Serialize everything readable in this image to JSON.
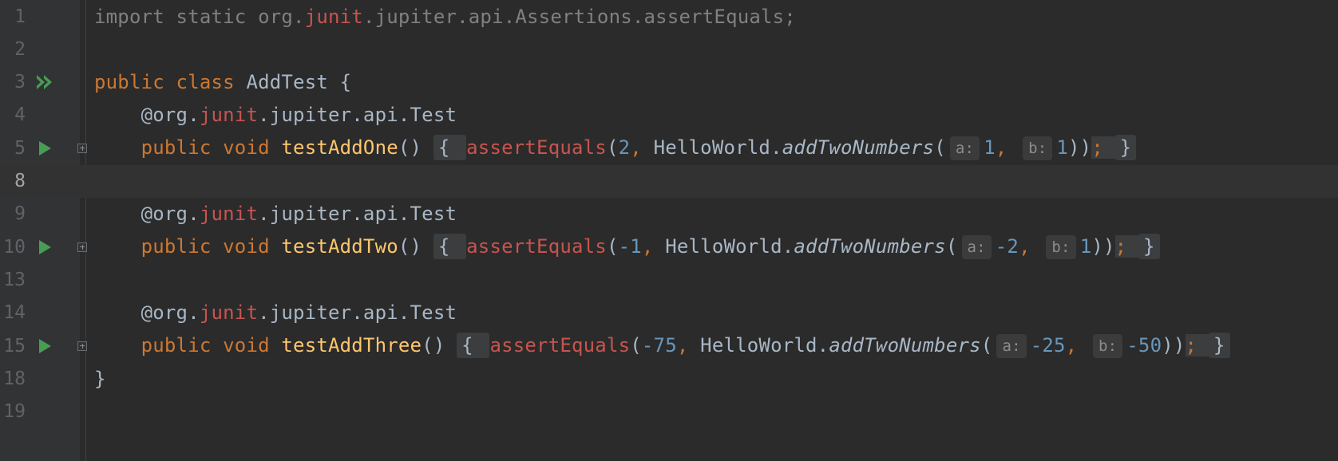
{
  "lines": [
    {
      "num": "1",
      "tokens": [
        {
          "t": "import static org.",
          "c": "muted"
        },
        {
          "t": "junit",
          "c": "red"
        },
        {
          "t": ".jupiter.api.Assertions.assertEquals;",
          "c": "muted"
        }
      ]
    },
    {
      "num": "2",
      "tokens": []
    },
    {
      "num": "3",
      "gutter": "run-all",
      "tokens": [
        {
          "t": "public class ",
          "c": "kw"
        },
        {
          "t": "AddTest ",
          "c": "punc"
        },
        {
          "t": "{",
          "c": "punc"
        }
      ]
    },
    {
      "num": "4",
      "tokens": [
        {
          "t": "    @org.",
          "c": "punc"
        },
        {
          "t": "junit",
          "c": "red"
        },
        {
          "t": ".jupiter.api.Test",
          "c": "punc"
        }
      ]
    },
    {
      "num": "5",
      "gutter": "run",
      "fold": true,
      "tokens": [
        {
          "t": "    public void ",
          "c": "kw"
        },
        {
          "t": "testAddOne",
          "c": "fn"
        },
        {
          "t": "() ",
          "c": "punc"
        },
        {
          "t": "{ ",
          "c": "fold-box"
        },
        {
          "t": "assertEquals",
          "c": "red"
        },
        {
          "t": "(",
          "c": "punc"
        },
        {
          "t": "2",
          "c": "num"
        },
        {
          "t": ", ",
          "c": "kw"
        },
        {
          "t": "HelloWorld.",
          "c": "punc"
        },
        {
          "t": "addTwoNumbers",
          "c": "it"
        },
        {
          "t": "(",
          "c": "punc"
        },
        {
          "hint": "a:"
        },
        {
          "t": "1",
          "c": "num"
        },
        {
          "t": ", ",
          "c": "kw"
        },
        {
          "hint": "b:"
        },
        {
          "t": "1",
          "c": "num"
        },
        {
          "t": "))",
          "c": "punc"
        },
        {
          "t": "; ",
          "c": "fold-semi"
        },
        {
          "t": "}",
          "c": "fold-box"
        }
      ]
    },
    {
      "num": "8",
      "current": true,
      "tokens": []
    },
    {
      "num": "9",
      "tokens": [
        {
          "t": "    @org.",
          "c": "punc"
        },
        {
          "t": "junit",
          "c": "red"
        },
        {
          "t": ".jupiter.api.Test",
          "c": "punc"
        }
      ]
    },
    {
      "num": "10",
      "gutter": "run",
      "fold": true,
      "tokens": [
        {
          "t": "    public void ",
          "c": "kw"
        },
        {
          "t": "testAddTwo",
          "c": "fn"
        },
        {
          "t": "() ",
          "c": "punc"
        },
        {
          "t": "{ ",
          "c": "fold-box"
        },
        {
          "t": "assertEquals",
          "c": "red"
        },
        {
          "t": "(",
          "c": "punc"
        },
        {
          "t": "-1",
          "c": "num"
        },
        {
          "t": ", ",
          "c": "kw"
        },
        {
          "t": "HelloWorld.",
          "c": "punc"
        },
        {
          "t": "addTwoNumbers",
          "c": "it"
        },
        {
          "t": "(",
          "c": "punc"
        },
        {
          "hint": "a:"
        },
        {
          "t": "-2",
          "c": "num"
        },
        {
          "t": ", ",
          "c": "kw"
        },
        {
          "hint": "b:"
        },
        {
          "t": "1",
          "c": "num"
        },
        {
          "t": "))",
          "c": "punc"
        },
        {
          "t": "; ",
          "c": "fold-semi"
        },
        {
          "t": "}",
          "c": "fold-box"
        }
      ]
    },
    {
      "num": "13",
      "tokens": []
    },
    {
      "num": "14",
      "tokens": [
        {
          "t": "    @org.",
          "c": "punc"
        },
        {
          "t": "junit",
          "c": "red"
        },
        {
          "t": ".jupiter.api.Test",
          "c": "punc"
        }
      ]
    },
    {
      "num": "15",
      "gutter": "run",
      "fold": true,
      "tokens": [
        {
          "t": "    public void ",
          "c": "kw"
        },
        {
          "t": "testAddThree",
          "c": "fn"
        },
        {
          "t": "() ",
          "c": "punc"
        },
        {
          "t": "{ ",
          "c": "fold-box"
        },
        {
          "t": "assertEquals",
          "c": "red"
        },
        {
          "t": "(",
          "c": "punc"
        },
        {
          "t": "-75",
          "c": "num"
        },
        {
          "t": ", ",
          "c": "kw"
        },
        {
          "t": "HelloWorld.",
          "c": "punc"
        },
        {
          "t": "addTwoNumbers",
          "c": "it"
        },
        {
          "t": "(",
          "c": "punc"
        },
        {
          "hint": "a:"
        },
        {
          "t": "-25",
          "c": "num"
        },
        {
          "t": ", ",
          "c": "kw"
        },
        {
          "hint": "b:"
        },
        {
          "t": "-50",
          "c": "num"
        },
        {
          "t": "))",
          "c": "punc"
        },
        {
          "t": "; ",
          "c": "fold-semi"
        },
        {
          "t": "}",
          "c": "fold-box"
        }
      ]
    },
    {
      "num": "18",
      "tokens": [
        {
          "t": "}",
          "c": "punc"
        }
      ]
    },
    {
      "num": "19",
      "tokens": []
    }
  ],
  "colors": {
    "background": "#2b2b2b",
    "gutter": "#313335",
    "keyword": "#cc7832",
    "error_red": "#c75450",
    "number": "#6897bb",
    "method_decl": "#ffc66d",
    "text": "#a9b7c6",
    "run_icon": "#499c54"
  },
  "icons": {
    "run_all": "double-run-arrow-icon",
    "run": "run-arrow-icon",
    "fold": "fold-expand-icon"
  }
}
